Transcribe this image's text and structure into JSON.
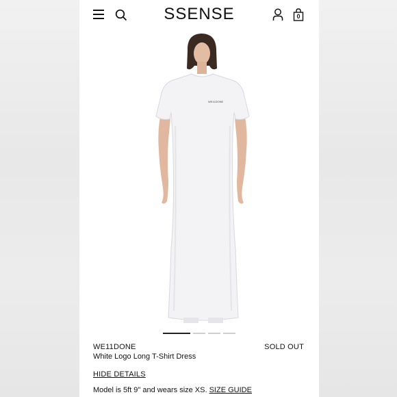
{
  "header": {
    "logo": "SSENSE",
    "menu_icon": "menu-icon",
    "search_icon": "search-icon",
    "account_icon": "account-icon",
    "bag_icon": "shopping-bag-icon",
    "bag_count": "0"
  },
  "gallery": {
    "image": "model-wearing-white-long-tshirt-dress",
    "print_text": "WE11DONE",
    "image_count": 4,
    "active_index": 0
  },
  "product": {
    "brand": "WE11DONE",
    "name": "White Logo Long T-Shirt Dress",
    "status": "SOLD OUT",
    "hide_details_label": "HIDE DETAILS",
    "model_info": "Model is 5ft 9\" and wears size XS. ",
    "size_guide_label": "SIZE GUIDE"
  }
}
